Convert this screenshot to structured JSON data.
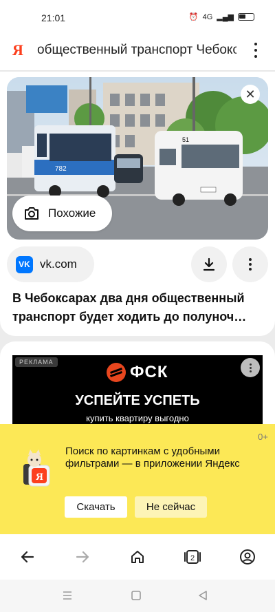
{
  "status_bar": {
    "time": "21:01",
    "network": "4G"
  },
  "search": {
    "logo": "Я",
    "query": "общественный транспорт Чебоксары"
  },
  "result": {
    "similar_label": "Похожие",
    "source": {
      "icon_text": "VK",
      "label": "vk.com"
    },
    "title": "В Чебоксарах два дня общественный транспорт будет ходить до полуноч…"
  },
  "ad": {
    "tag": "РЕКЛАМА",
    "brand": "ФСК",
    "headline": "УСПЕЙТЕ УСПЕТЬ",
    "subline": "купить квартиру выгодно"
  },
  "promo": {
    "age": "0+",
    "text": "Поиск по картинкам с удобными фильтрами — в приложении Яндекс",
    "install_label": "Скачать",
    "dismiss_label": "Не сейчас"
  },
  "nav": {
    "tabs_count": "2"
  },
  "icons": [
    "close-icon",
    "camera-search-icon",
    "download-icon",
    "more-icon",
    "back-icon",
    "forward-icon",
    "home-icon",
    "tabs-icon",
    "profile-icon"
  ],
  "colors": {
    "yandex_red": "#fc3f1d",
    "vk_blue": "#0077ff",
    "promo_yellow": "#fce856",
    "fsk_orange": "#e8461e"
  }
}
